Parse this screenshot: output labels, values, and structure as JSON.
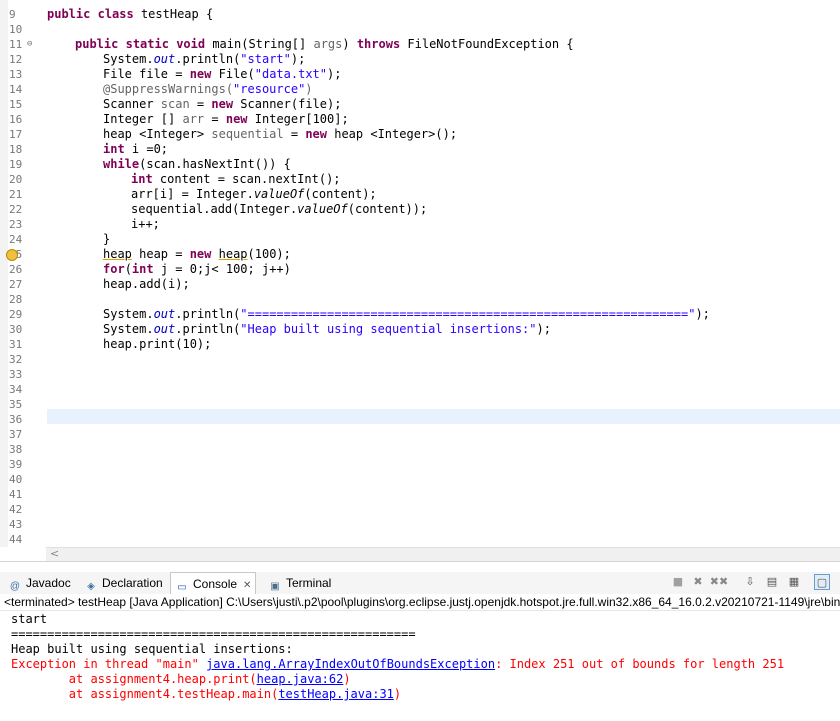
{
  "editor": {
    "line_numbers": [
      "9",
      "10",
      "11",
      "12",
      "13",
      "14",
      "15",
      "16",
      "17",
      "18",
      "19",
      "20",
      "21",
      "22",
      "23",
      "24",
      "25",
      "26",
      "27",
      "28",
      "29",
      "30",
      "31",
      "32",
      "33",
      "34",
      "35",
      "36",
      "37",
      "38",
      "39",
      "40",
      "41",
      "42",
      "43",
      "44"
    ],
    "code": {
      "l9": [
        "public",
        " ",
        "class",
        " testHeap {"
      ],
      "l11": [
        "public",
        " ",
        "static",
        " ",
        "void",
        " main(String[] ",
        "args",
        ") ",
        "throws",
        " FileNotFoundException {"
      ],
      "l12": [
        "System.",
        "out",
        ".println(",
        "\"start\"",
        ");"
      ],
      "l13": [
        "File file = ",
        "new",
        " File(",
        "\"data.txt\"",
        ");"
      ],
      "l14": [
        "@SuppressWarnings(",
        "\"resource\"",
        ")"
      ],
      "l15": [
        "Scanner ",
        "scan",
        " = ",
        "new",
        " Scanner(file);"
      ],
      "l16": [
        "Integer [] ",
        "arr",
        " = ",
        "new",
        " Integer[100];"
      ],
      "l17": [
        "heap <Integer> ",
        "sequential",
        " = ",
        "new",
        " heap <Integer>();"
      ],
      "l18": [
        "int",
        " i =0;"
      ],
      "l19": [
        "while",
        "(scan.hasNextInt()) {"
      ],
      "l20": [
        "int",
        " content = scan.nextInt();"
      ],
      "l21": [
        "arr[i] = Integer.",
        "valueOf",
        "(content);"
      ],
      "l22": [
        "sequential.add(Integer.",
        "valueOf",
        "(content));"
      ],
      "l23": [
        "i++;"
      ],
      "l24": [
        "}"
      ],
      "l25": [
        "heap",
        " heap = ",
        "new",
        " ",
        "heap",
        "(100);"
      ],
      "l26": [
        "for",
        "(",
        "int",
        " j = 0;j< 100; j++)"
      ],
      "l27": [
        "heap.add(i);"
      ],
      "l29": [
        "System.",
        "out",
        ".println(",
        "\"=============================================================\"",
        ");"
      ],
      "l30": [
        "System.",
        "out",
        ".println(",
        "\"Heap built using sequential insertions:\"",
        ");"
      ],
      "l31": [
        "heap.print(10);"
      ]
    }
  },
  "scrollbar": {
    "left_arrow": "<"
  },
  "panel": {
    "tabs": {
      "javadoc": {
        "label": "Javadoc",
        "icon": "at-icon",
        "glyph": "@"
      },
      "declaration": {
        "label": "Declaration",
        "icon": "declaration-icon",
        "glyph": "◈"
      },
      "console": {
        "label": "Console",
        "icon": "console-icon",
        "glyph": "▭",
        "close": "✕"
      },
      "terminal": {
        "label": "Terminal",
        "icon": "terminal-icon",
        "glyph": "▣"
      }
    },
    "toolbar": {
      "terminate": "■",
      "remove": "✖",
      "remove_all": "✖✖",
      "scroll_lock": "⇩",
      "pin": "▤",
      "display": "▦",
      "open_console": "▢"
    },
    "status": "<terminated> testHeap [Java Application] C:\\Users\\justi\\.p2\\pool\\plugins\\org.eclipse.justj.openjdk.hotspot.jre.full.win32.x86_64_16.0.2.v20210721-1149\\jre\\bin",
    "console": {
      "line1": "start",
      "line2": "========================================================",
      "line3": "Heap built using sequential insertions:",
      "err_prefix": "Exception in thread \"main\" ",
      "err_link": "java.lang.ArrayIndexOutOfBoundsException",
      "err_suffix": ": Index 251 out of bounds for length 251",
      "at1_prefix": "\tat assignment4.heap.print(",
      "at1_link": "heap.java:62",
      "at1_suffix": ")",
      "at2_prefix": "\tat assignment4.testHeap.main(",
      "at2_link": "testHeap.java:31",
      "at2_suffix": ")"
    }
  }
}
